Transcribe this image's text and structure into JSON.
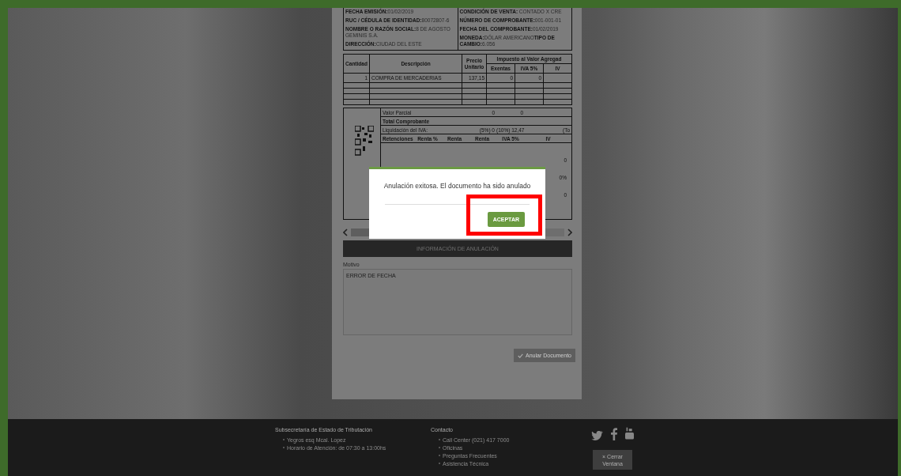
{
  "document": {
    "header_left": [
      "**FECHA EMISIÓN:**01/02/2019",
      "**RUC / CÉDULA DE IDENTIDAD:**80072807-6",
      "**NOMBRE O RAZÓN SOCIAL:**8 DE AGOSTO GEMINIS S.A.",
      "**DIRECCIÓN:**CIUDAD DEL ESTE"
    ],
    "header_right": [
      "**CONDICIÓN DE VENTA:** CONTADO X CRE",
      "**NÚMERO DE COMPROBANTE:**001-001-01",
      "**FECHA DEL COMPROBANTE:**01/02/2019",
      "**MONEDA:**DÓLAR AMERICANO**TIPO DE CAMBIO:**6.056"
    ],
    "items_table": {
      "columns": [
        "Cantidad",
        "Descripción",
        "Precio Unitario"
      ],
      "group_heading": "Impuesto al Valor Agregad",
      "sub_columns": [
        "Exentas",
        "IVA 5%",
        "IV"
      ],
      "rows": [
        [
          "1",
          "COMPRA DE MERCADERIAS",
          "137,15",
          "0",
          "0"
        ]
      ]
    },
    "summary": {
      "rows": [
        {
          "kind": "value",
          "label": "Valor Parcial",
          "cells": [
            "0",
            "0"
          ]
        },
        {
          "kind": "heading",
          "label": "Total Comprobante",
          "cells": []
        },
        {
          "kind": "value",
          "label": "Liquidación del IVA:",
          "cells": [
            "(5%) 0",
            "(10%) 12,47",
            "(To"
          ]
        },
        {
          "kind": "columns",
          "label": "Retenciones",
          "cells": [
            "Renta %",
            "Renta",
            "Renta",
            "IVA 5%",
            "IV"
          ]
        }
      ],
      "side_values": [
        "0",
        "0%",
        "0"
      ]
    },
    "annulment": {
      "heading": "INFORMACIÓN DE ANULACIÓN",
      "reason_label": "Motivo",
      "reason_value": "ERROR DE FECHA",
      "submit_button": "Anular Documento"
    }
  },
  "footer": {
    "columns": [
      {
        "title": "Subsecretaría de Estado de Tributación",
        "items": [
          "Yegros esq Mcal. Lopez",
          "Horario de Atención: de 07:30 a 13:00hs"
        ]
      },
      {
        "title": "Contacto",
        "items": [
          "Call Center (021) 417 7000",
          "Oficinas",
          "Preguntas Frecuentes",
          "Asistencia Técnica"
        ]
      }
    ],
    "close_button": {
      "glyph": "×",
      "label": "Cerrar Ventana"
    }
  },
  "dialog": {
    "message": "Anulación exitosa. El documento ha sido anulado",
    "button": "ACEPTAR",
    "highlighted": true
  }
}
